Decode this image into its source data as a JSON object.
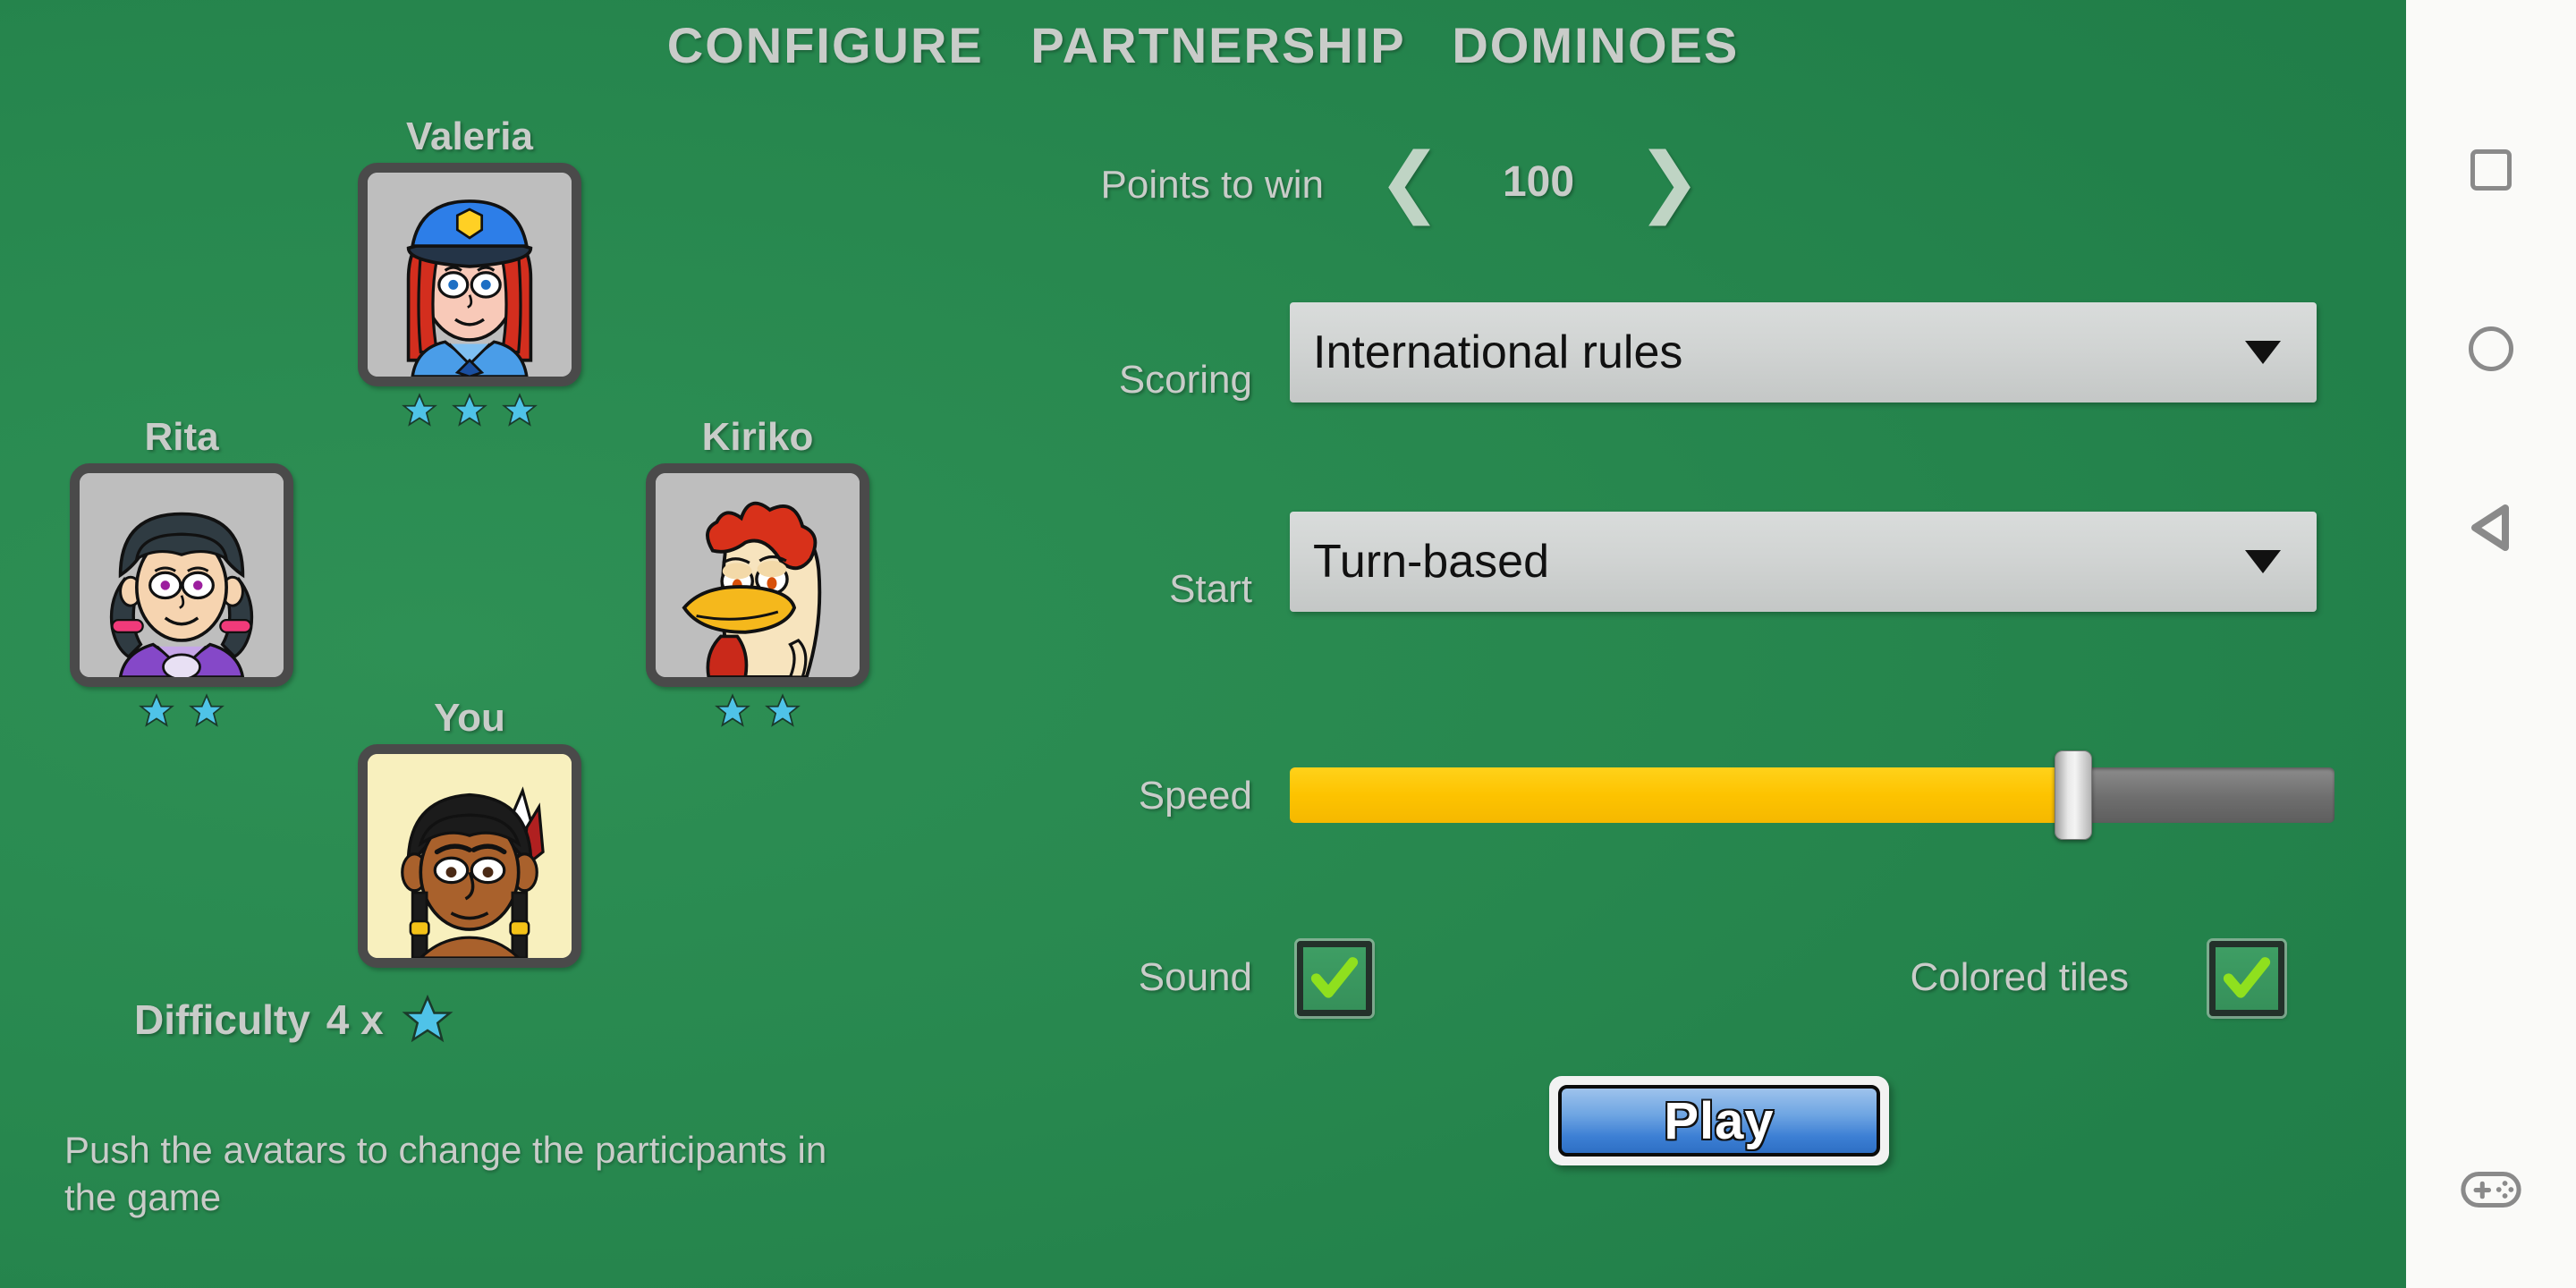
{
  "app": {
    "title": "CONFIGURE   PARTNERSHIP   DOMINOES",
    "background_color": "#23814B",
    "label_color": "#C9CCC9",
    "star_color": "#4FC3E8",
    "accent_yellow": "#FDC300",
    "check_color": "#8FE01E",
    "play_blue": "#3C7FD4"
  },
  "players": [
    {
      "name": "Valeria",
      "avatar": "police-officer-avatar",
      "stars": 3,
      "position": "top-center"
    },
    {
      "name": "Rita",
      "avatar": "braided-girl-avatar",
      "stars": 2,
      "position": "left"
    },
    {
      "name": "Kiriko",
      "avatar": "rooster-avatar",
      "stars": 2,
      "position": "right"
    },
    {
      "name": "You",
      "avatar": "native-american-avatar",
      "stars": 0,
      "position": "bottom-center"
    }
  ],
  "difficulty": {
    "label": "Difficulty",
    "value": "4 x",
    "star_icon": "star-icon"
  },
  "hint": "Push the avatars to change the participants in the game",
  "settings": {
    "points_to_win": {
      "label": "Points to win",
      "value": "100",
      "prev_icon": "chevron-left-icon",
      "next_icon": "chevron-right-icon",
      "prev_glyph": "❮",
      "next_glyph": "❯"
    },
    "scoring": {
      "label": "Scoring",
      "value": "International rules",
      "arrow_icon": "chevron-down-icon"
    },
    "start": {
      "label": "Start",
      "value": "Turn-based",
      "arrow_icon": "chevron-down-icon"
    },
    "speed": {
      "label": "Speed",
      "percent": 75
    },
    "sound": {
      "label": "Sound",
      "checked": true
    },
    "colored_tiles": {
      "label": "Colored tiles",
      "checked": true
    }
  },
  "play_button": {
    "label": "Play"
  },
  "navbar": {
    "items": [
      {
        "icon": "recents-square-icon",
        "name": "recents-button"
      },
      {
        "icon": "home-circle-icon",
        "name": "home-button"
      },
      {
        "icon": "back-triangle-icon",
        "name": "back-button"
      },
      {
        "icon": "gamepad-icon",
        "name": "game-tools-button"
      }
    ]
  }
}
